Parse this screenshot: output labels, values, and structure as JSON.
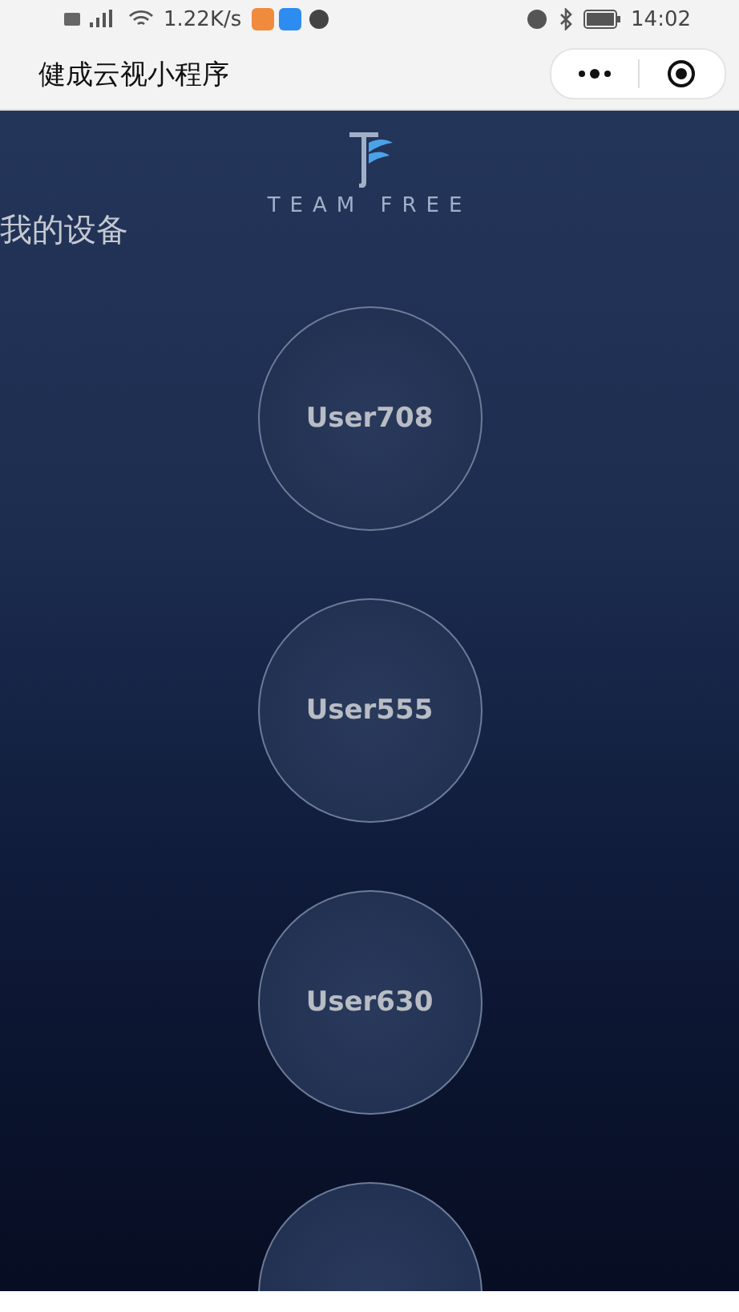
{
  "status_bar": {
    "speed": "1.22K/s",
    "time": "14:02"
  },
  "nav_bar": {
    "title": "健成云视小程序"
  },
  "logo": {
    "text": "TEAM FREE"
  },
  "section_title": "我的设备",
  "devices": [
    {
      "name": "User708"
    },
    {
      "name": "User555"
    },
    {
      "name": "User630"
    }
  ],
  "more_devices_below": true
}
